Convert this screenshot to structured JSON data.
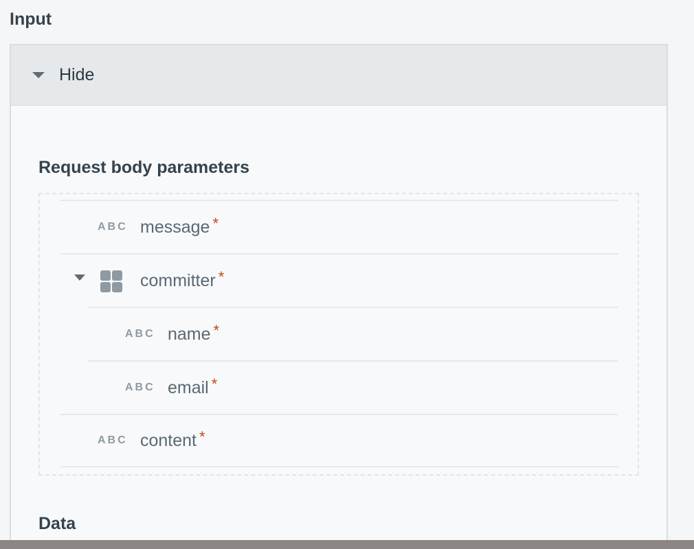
{
  "input_section": {
    "title": "Input"
  },
  "panel": {
    "toggle_label": "Hide",
    "request_body_title": "Request body parameters",
    "data_title": "Data"
  },
  "params": [
    {
      "type_label": "ABC",
      "name": "message",
      "required_mark": "*"
    },
    {
      "type_label": "",
      "name": "committer",
      "required_mark": "*",
      "icon": "object-grid-icon",
      "expanded": true
    },
    {
      "type_label": "ABC",
      "name": "name",
      "required_mark": "*"
    },
    {
      "type_label": "ABC",
      "name": "email",
      "required_mark": "*"
    },
    {
      "type_label": "ABC",
      "name": "content",
      "required_mark": "*"
    }
  ],
  "colors": {
    "required": "#c4451c",
    "header_bg": "#e6e9eb"
  }
}
